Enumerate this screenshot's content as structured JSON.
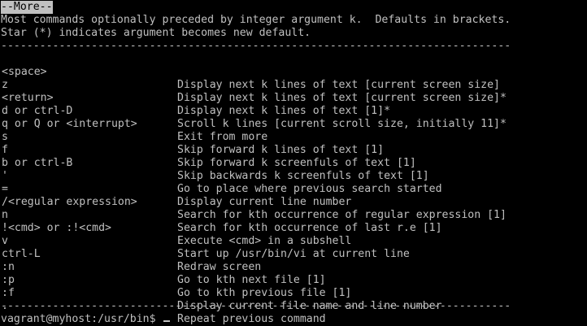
{
  "more_prompt": "--More--",
  "intro": [
    "Most commands optionally preceded by integer argument k.  Defaults in brackets.",
    "Star (*) indicates argument becomes new default."
  ],
  "separator": "-------------------------------------------------------------------------------",
  "commands": [
    {
      "key": "<space>",
      "desc": "Display next k lines of text [current screen size]"
    },
    {
      "key": "z",
      "desc": "Display next k lines of text [current screen size]*"
    },
    {
      "key": "<return>",
      "desc": "Display next k lines of text [1]*"
    },
    {
      "key": "d or ctrl-D",
      "desc": "Scroll k lines [current scroll size, initially 11]*"
    },
    {
      "key": "q or Q or <interrupt>",
      "desc": "Exit from more"
    },
    {
      "key": "s",
      "desc": "Skip forward k lines of text [1]"
    },
    {
      "key": "f",
      "desc": "Skip forward k screenfuls of text [1]"
    },
    {
      "key": "b or ctrl-B",
      "desc": "Skip backwards k screenfuls of text [1]"
    },
    {
      "key": "'",
      "desc": "Go to place where previous search started"
    },
    {
      "key": "=",
      "desc": "Display current line number"
    },
    {
      "key": "/<regular expression>",
      "desc": "Search for kth occurrence of regular expression [1]"
    },
    {
      "key": "n",
      "desc": "Search for kth occurrence of last r.e [1]"
    },
    {
      "key": "!<cmd> or :!<cmd>",
      "desc": "Execute <cmd> in a subshell"
    },
    {
      "key": "v",
      "desc": "Start up /usr/bin/vi at current line"
    },
    {
      "key": "ctrl-L",
      "desc": "Redraw screen"
    },
    {
      "key": ":n",
      "desc": "Go to kth next file [1]"
    },
    {
      "key": ":p",
      "desc": "Go to kth previous file [1]"
    },
    {
      "key": ":f",
      "desc": "Display current file name and line number"
    },
    {
      "key": ".",
      "desc": "Repeat previous command"
    }
  ],
  "shell_prompt": "vagrant@myhost:/usr/bin$ ",
  "colors": {
    "background": "#000000",
    "foreground": "#c0c0c0"
  }
}
